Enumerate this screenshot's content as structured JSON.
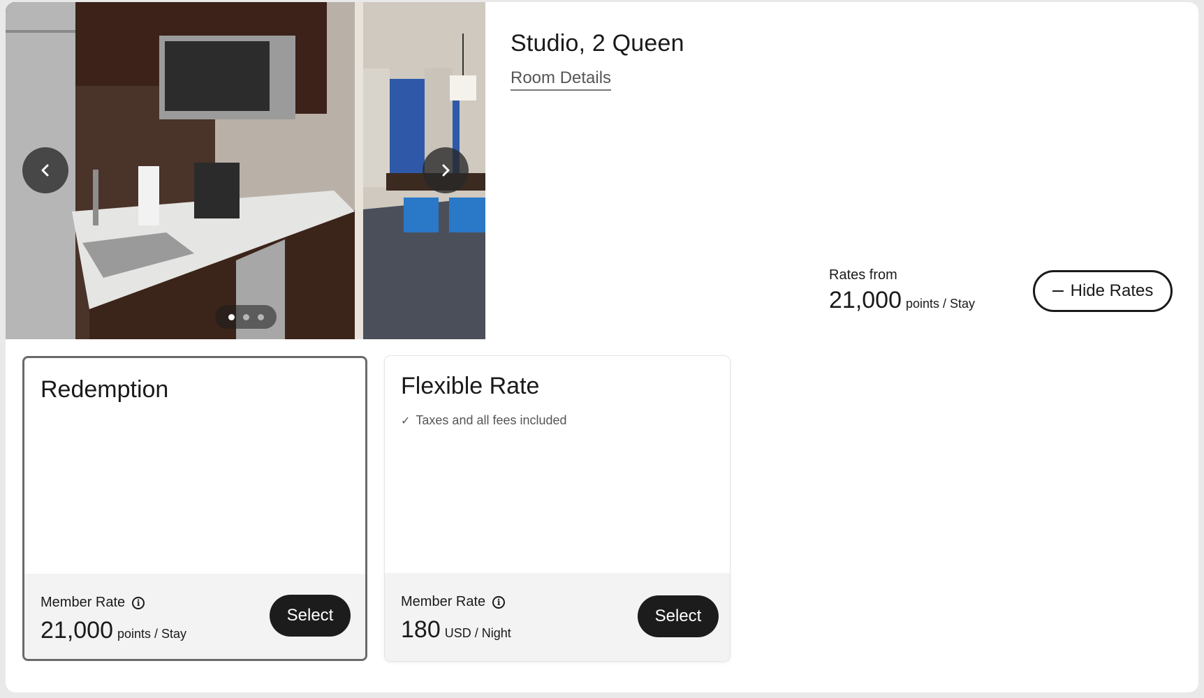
{
  "room": {
    "title": "Studio, 2 Queen",
    "details_link": "Room Details"
  },
  "gallery": {
    "prev_icon": "chevron-left-icon",
    "next_icon": "chevron-right-icon",
    "total_images": 3,
    "active_index": 0
  },
  "rates_summary": {
    "label": "Rates from",
    "amount": "21,000",
    "unit": "points / Stay",
    "toggle_label": "Hide Rates"
  },
  "rates": [
    {
      "title": "Redemption",
      "feature": "",
      "member_label": "Member Rate",
      "amount": "21,000",
      "unit": "points / Stay",
      "select_label": "Select",
      "selected": true
    },
    {
      "title": "Flexible Rate",
      "feature": "Taxes and all fees included",
      "member_label": "Member Rate",
      "amount": "180",
      "unit": "USD / Night",
      "select_label": "Select",
      "selected": false
    }
  ]
}
